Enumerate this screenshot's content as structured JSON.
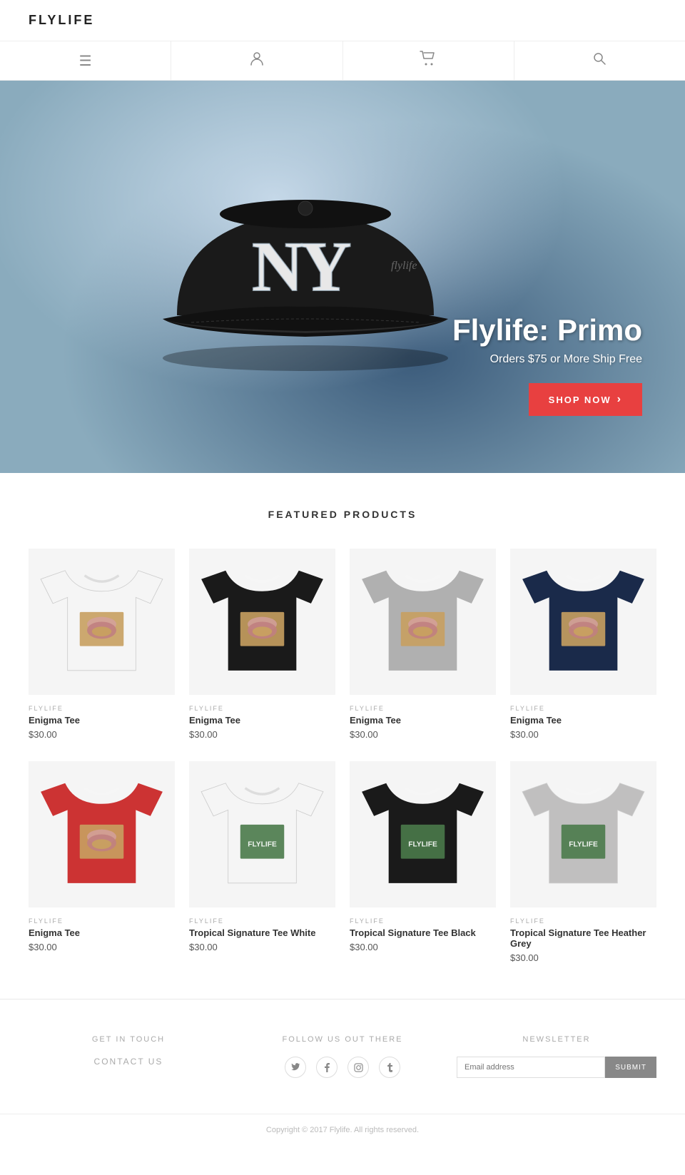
{
  "header": {
    "logo": "FLYLIFE"
  },
  "nav": {
    "items": [
      {
        "icon": "≡",
        "label": "menu-icon"
      },
      {
        "icon": "👤",
        "label": "account-icon"
      },
      {
        "icon": "🛒",
        "label": "cart-icon"
      },
      {
        "icon": "🔍",
        "label": "search-icon"
      }
    ]
  },
  "hero": {
    "title": "Flylife: Primo",
    "subtitle": "Orders $75 or More Ship Free",
    "cta_label": "ShOP NOW",
    "cta_arrow": "›"
  },
  "featured": {
    "section_title": "FEATURED PRODUCTS",
    "products": [
      {
        "brand": "FLYLIFE",
        "name": "Enigma Tee",
        "price": "$30.00",
        "color": "white",
        "type": "enigma"
      },
      {
        "brand": "FLYLIFE",
        "name": "Enigma Tee",
        "price": "$30.00",
        "color": "black",
        "type": "enigma"
      },
      {
        "brand": "FLYLIFE",
        "name": "Enigma Tee",
        "price": "$30.00",
        "color": "grey",
        "type": "enigma"
      },
      {
        "brand": "FLYLIFE",
        "name": "Enigma Tee",
        "price": "$30.00",
        "color": "navy",
        "type": "enigma"
      },
      {
        "brand": "FLYLIFE",
        "name": "Enigma Tee",
        "price": "$30.00",
        "color": "red",
        "type": "enigma"
      },
      {
        "brand": "FLYLIFE",
        "name": "Tropical Signature Tee White",
        "price": "$30.00",
        "color": "white",
        "type": "tropical"
      },
      {
        "brand": "FLYLIFE",
        "name": "Tropical Signature Tee Black",
        "price": "$30.00",
        "color": "black",
        "type": "tropical"
      },
      {
        "brand": "FLYLIFE",
        "name": "Tropical Signature Tee Heather Grey",
        "price": "$30.00",
        "color": "heathergrey",
        "type": "tropical"
      }
    ]
  },
  "footer": {
    "col1": {
      "heading": "GET IN TOUCH",
      "link": "CONTACT US"
    },
    "col2": {
      "heading": "FOLLOW US OUT THERE",
      "socials": [
        "𝕏",
        "f",
        "📷",
        "t"
      ]
    },
    "col3": {
      "heading": "NEWSLETTER",
      "placeholder": "Email address",
      "submit": "SUBMIT"
    },
    "copyright": "Copyright © 2017 Flylife. All rights reserved."
  }
}
